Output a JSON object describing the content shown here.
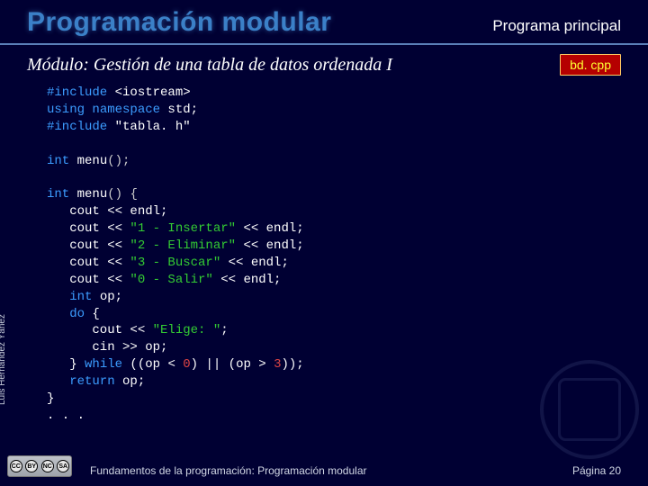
{
  "header": {
    "title": "Programación modular",
    "right": "Programa principal"
  },
  "module": {
    "title": "Módulo: Gestión de una tabla de datos ordenada I",
    "badge": "bd. cpp"
  },
  "code": {
    "l1a": "#include",
    "l1b": " <iostream>",
    "l2a": "using",
    "l2b": " namespace",
    "l2c": " std;",
    "l3a": "#include",
    "l3b": " \"tabla. h\"",
    "l5a": "int",
    "l5b": " menu",
    "l5c": "();",
    "l7a": "int",
    "l7b": " menu",
    "l7c": "() {",
    "l8a": "   cout << endl;",
    "l9a": "   cout << ",
    "l9b": "\"1 - Insertar\"",
    "l9c": " << endl;",
    "l10a": "   cout << ",
    "l10b": "\"2 - Eliminar\"",
    "l10c": " << endl;",
    "l11a": "   cout << ",
    "l11b": "\"3 - Buscar\"",
    "l11c": " << endl;",
    "l12a": "   cout << ",
    "l12b": "\"0 - Salir\"",
    "l12c": " << endl;",
    "l13a": "   int",
    "l13b": " op;",
    "l14a": "   do",
    "l14b": " {",
    "l15a": "      cout << ",
    "l15b": "\"Elige: \"",
    "l15c": ";",
    "l16a": "      cin >> op;",
    "l17a": "   } ",
    "l17b": "while",
    "l17c": " ((op < ",
    "l17d": "0",
    "l17e": ") || (op > ",
    "l17f": "3",
    "l17g": "));",
    "l18a": "   return",
    "l18b": " op;",
    "l19a": "}",
    "l20a": ". . ."
  },
  "author": "Luis Hernández Yáñez",
  "cc": {
    "label": "CC",
    "by": "BY",
    "nc": "NC",
    "sa": "SA"
  },
  "footer": {
    "left": "Fundamentos de la programación: Programación modular",
    "right": "Página 20"
  }
}
